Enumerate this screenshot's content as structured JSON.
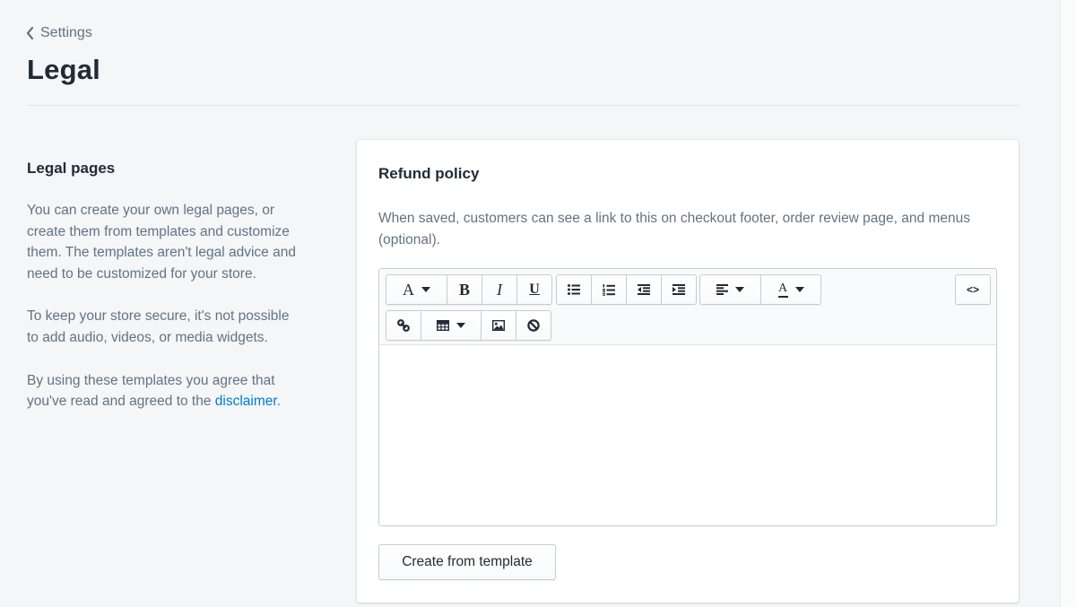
{
  "breadcrumb": {
    "label": "Settings"
  },
  "page": {
    "title": "Legal"
  },
  "annotation": {
    "heading": "Legal pages",
    "paragraph1": "You can create your own legal pages, or create them from templates and customize them. The templates aren't legal advice and need to be customized for your store.",
    "paragraph2": "To keep your store secure, it's not possible to add audio, videos, or media widgets.",
    "paragraph3_prefix": "By using these templates you agree that you've read and agreed to the",
    "disclaimer_link": "disclaimer",
    "paragraph3_suffix": "."
  },
  "card": {
    "title": "Refund policy",
    "help_text": "When saved, customers can see a link to this on checkout footer, order review page, and menus (optional).",
    "template_button": "Create from template"
  },
  "toolbar": {
    "font_label": "A",
    "bold_label": "B",
    "italic_label": "I",
    "underline_label": "U",
    "text_color_label": "A",
    "code_label": "<>"
  },
  "colors": {
    "background": "#f4f6f8",
    "link": "#007ace",
    "text": "#212b36",
    "muted": "#637381"
  }
}
